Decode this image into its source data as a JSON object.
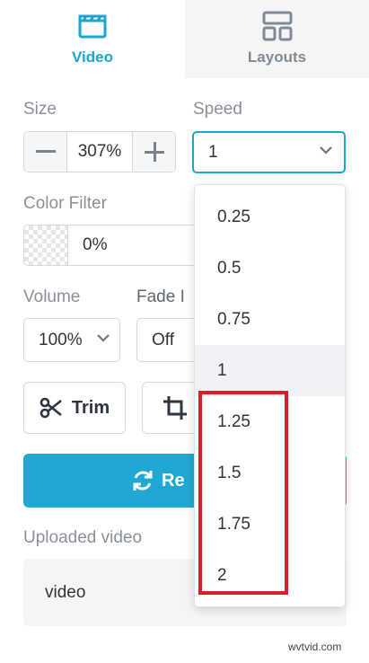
{
  "tabs": [
    {
      "label": "Video",
      "icon": "clapperboard-icon",
      "active": true
    },
    {
      "label": "Layouts",
      "icon": "layouts-icon",
      "active": false
    }
  ],
  "size": {
    "label": "Size",
    "value": "307%"
  },
  "speed": {
    "label": "Speed",
    "value": "1",
    "options": [
      "0.25",
      "0.5",
      "0.75",
      "1",
      "1.25",
      "1.5",
      "1.75",
      "2"
    ],
    "selected": "1"
  },
  "color_filter": {
    "label": "Color Filter",
    "value": "0%"
  },
  "volume": {
    "label": "Volume",
    "value": "100%"
  },
  "fade": {
    "label": "Fade In",
    "visible_label": "Fade I",
    "value": "Off"
  },
  "trim": {
    "label": "Trim"
  },
  "replace": {
    "label": "Re"
  },
  "uploaded": {
    "label": "Uploaded video",
    "value": "video"
  },
  "watermark": "wvtvid.com",
  "colors": {
    "accent": "#1ba5d0",
    "button": "#21a8d2",
    "highlight": "#d42127"
  }
}
